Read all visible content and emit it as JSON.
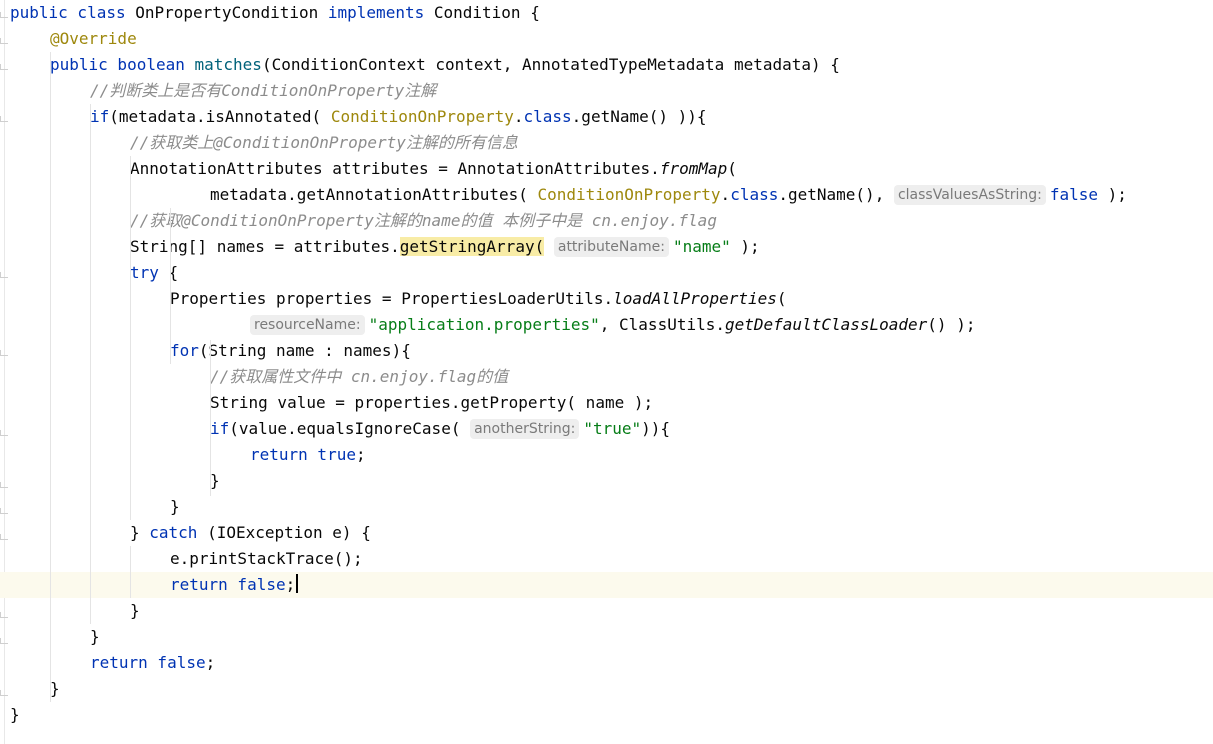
{
  "editor": {
    "lines": [
      {
        "indent": 0,
        "tokens": [
          {
            "t": "public class ",
            "c": "kw"
          },
          {
            "t": "OnPropertyCondition "
          },
          {
            "t": "implements ",
            "c": "kw"
          },
          {
            "t": "Condition {"
          }
        ]
      },
      {
        "indent": 1,
        "tokens": [
          {
            "t": "@Override",
            "c": "ann"
          }
        ]
      },
      {
        "indent": 1,
        "tokens": [
          {
            "t": "public boolean ",
            "c": "kw"
          },
          {
            "t": "matches",
            "c": "fn"
          },
          {
            "t": "(ConditionContext context, AnnotatedTypeMetadata metadata) {"
          }
        ]
      },
      {
        "indent": 2,
        "tokens": [
          {
            "t": "//判断类上是否有ConditionOnProperty注解",
            "c": "cmt"
          }
        ]
      },
      {
        "indent": 2,
        "tokens": [
          {
            "t": "if",
            "c": "kw"
          },
          {
            "t": "(metadata.isAnnotated( "
          },
          {
            "t": "ConditionOnProperty",
            "c": "cls"
          },
          {
            "t": "."
          },
          {
            "t": "class",
            "c": "kw"
          },
          {
            "t": ".getName() )){"
          }
        ]
      },
      {
        "indent": 3,
        "tokens": [
          {
            "t": "//获取类上@ConditionOnProperty注解的所有信息",
            "c": "cmt"
          }
        ]
      },
      {
        "indent": 3,
        "tokens": [
          {
            "t": "AnnotationAttributes attributes = AnnotationAttributes."
          },
          {
            "t": "fromMap",
            "c": "italic"
          },
          {
            "t": "("
          }
        ]
      },
      {
        "indent": 5,
        "tokens": [
          {
            "t": "metadata.getAnnotationAttributes( "
          },
          {
            "t": "ConditionOnProperty",
            "c": "cls"
          },
          {
            "t": "."
          },
          {
            "t": "class",
            "c": "kw"
          },
          {
            "t": ".getName(), "
          },
          {
            "t": "classValuesAsString:",
            "c": "hint"
          },
          {
            "t": "false",
            "c": "kw"
          },
          {
            "t": " );"
          }
        ]
      },
      {
        "indent": 3,
        "tokens": [
          {
            "t": "//获取@ConditionOnProperty注解的name的值 本例子中是 cn.enjoy.flag",
            "c": "cmt"
          }
        ]
      },
      {
        "indent": 3,
        "tokens": [
          {
            "t": "String[] names = attributes."
          },
          {
            "t": "getStringArray(",
            "c": "hl"
          },
          {
            "t": " "
          },
          {
            "t": "attributeName:",
            "c": "hint"
          },
          {
            "t": "\"name\"",
            "c": "str"
          },
          {
            "t": " );"
          }
        ]
      },
      {
        "indent": 3,
        "tokens": [
          {
            "t": "try",
            "c": "kw"
          },
          {
            "t": " {"
          }
        ]
      },
      {
        "indent": 4,
        "tokens": [
          {
            "t": "Properties properties = PropertiesLoaderUtils."
          },
          {
            "t": "loadAllProperties",
            "c": "italic"
          },
          {
            "t": "("
          }
        ]
      },
      {
        "indent": 6,
        "tokens": [
          {
            "t": "resourceName:",
            "c": "hint"
          },
          {
            "t": "\"application.properties\"",
            "c": "str"
          },
          {
            "t": ", ClassUtils."
          },
          {
            "t": "getDefaultClassLoader",
            "c": "italic"
          },
          {
            "t": "() );"
          }
        ]
      },
      {
        "indent": 4,
        "tokens": [
          {
            "t": "for",
            "c": "kw"
          },
          {
            "t": "(String name : names){"
          }
        ]
      },
      {
        "indent": 5,
        "tokens": [
          {
            "t": "//获取属性文件中 cn.enjoy.flag的值",
            "c": "cmt"
          }
        ]
      },
      {
        "indent": 5,
        "tokens": [
          {
            "t": "String value = properties.getProperty( name );"
          }
        ]
      },
      {
        "indent": 5,
        "tokens": [
          {
            "t": "if",
            "c": "kw"
          },
          {
            "t": "(value.equalsIgnoreCase( "
          },
          {
            "t": "anotherString:",
            "c": "hint"
          },
          {
            "t": "\"true\"",
            "c": "str"
          },
          {
            "t": ")){"
          }
        ]
      },
      {
        "indent": 6,
        "tokens": [
          {
            "t": "return true",
            "c": "kw"
          },
          {
            "t": ";"
          }
        ]
      },
      {
        "indent": 5,
        "tokens": [
          {
            "t": "}"
          }
        ]
      },
      {
        "indent": 4,
        "tokens": [
          {
            "t": "}"
          }
        ]
      },
      {
        "indent": 3,
        "tokens": [
          {
            "t": "} "
          },
          {
            "t": "catch",
            "c": "kw"
          },
          {
            "t": " (IOException e) {"
          }
        ]
      },
      {
        "indent": 4,
        "tokens": [
          {
            "t": "e.printStackTrace();"
          }
        ]
      },
      {
        "indent": 4,
        "current": true,
        "tokens": [
          {
            "t": "return false",
            "c": "kw"
          },
          {
            "t": ";"
          }
        ]
      },
      {
        "indent": 3,
        "tokens": [
          {
            "t": "}"
          }
        ]
      },
      {
        "indent": 2,
        "tokens": [
          {
            "t": "}"
          }
        ]
      },
      {
        "indent": 2,
        "tokens": [
          {
            "t": "return false",
            "c": "kw"
          },
          {
            "t": ";"
          }
        ]
      },
      {
        "indent": 1,
        "tokens": [
          {
            "t": "}"
          }
        ]
      },
      {
        "indent": 0,
        "tokens": [
          {
            "t": "}"
          }
        ]
      }
    ]
  },
  "colors": {
    "keyword": "#0033b3",
    "annotation": "#9e880d",
    "method": "#00627a",
    "string": "#067d17",
    "comment": "#8c8c8c",
    "current_line": "#fcfaed",
    "identifier_highlight": "#f8eca6"
  }
}
